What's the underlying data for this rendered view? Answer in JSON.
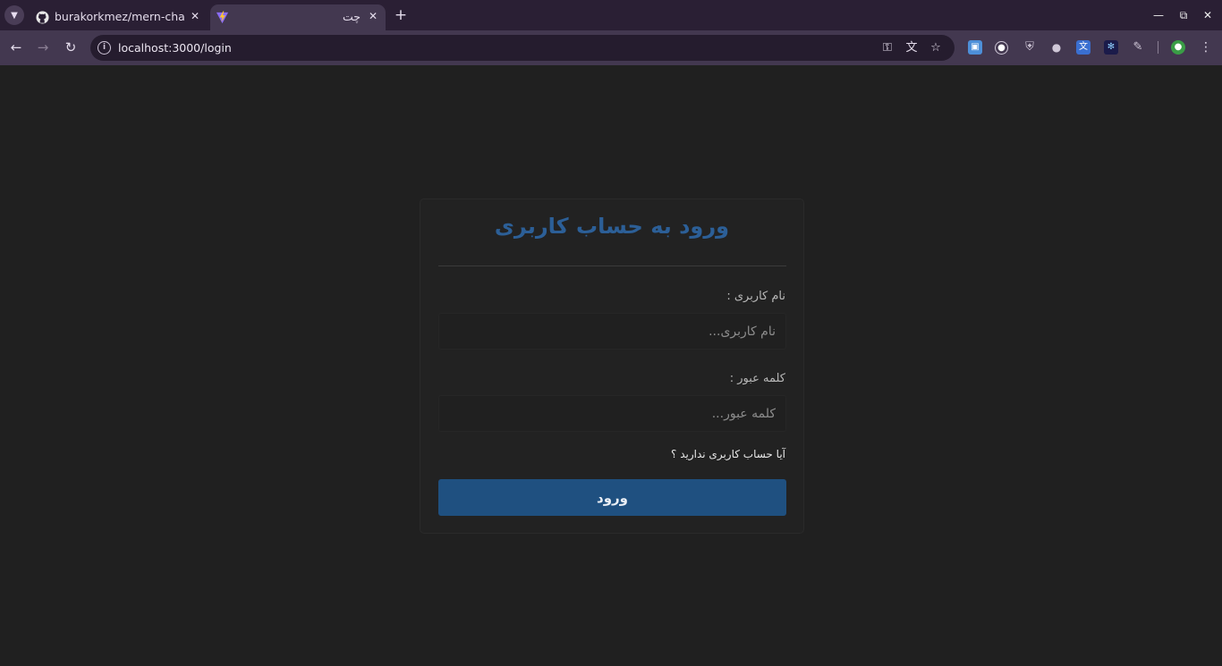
{
  "browser": {
    "tabs": [
      {
        "title": "burakorkmez/mern-chat",
        "active": false,
        "favicon": "github-icon"
      },
      {
        "title": "چت",
        "active": true,
        "favicon": "vite-icon"
      }
    ],
    "url": "localhost:3000/login"
  },
  "login": {
    "title": "ورود به حساب کاربری",
    "username_label": "نام کاربری :",
    "username_placeholder": "نام کاربری...",
    "password_label": "کلمه عبور :",
    "password_placeholder": "کلمه عبور...",
    "signup_link": "آیا حساب کاربری ندارید ؟",
    "submit_label": "ورود"
  },
  "colors": {
    "accent": "#2c5f97",
    "button": "#1f5080",
    "background": "#202020"
  }
}
